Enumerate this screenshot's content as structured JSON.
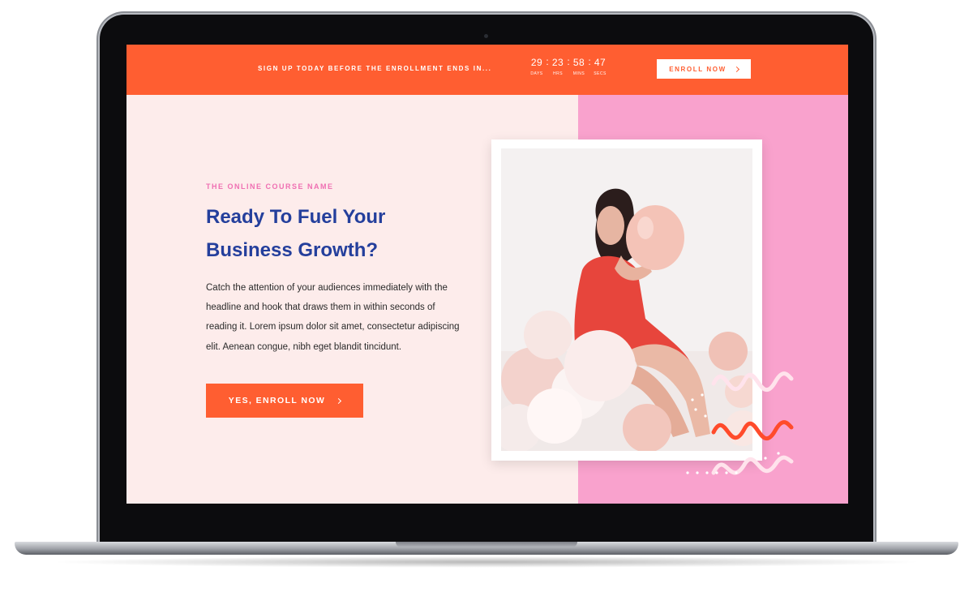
{
  "topbar": {
    "promo_text": "SIGN UP TODAY BEFORE THE ENROLLMENT ENDS IN...",
    "countdown": [
      {
        "value": "29",
        "label": "DAYS"
      },
      {
        "value": "23",
        "label": "HRS"
      },
      {
        "value": "58",
        "label": "MINS"
      },
      {
        "value": "47",
        "label": "SECS"
      }
    ],
    "separator": ":",
    "enroll_label": "ENROLL NOW"
  },
  "hero": {
    "eyebrow": "THE ONLINE COURSE NAME",
    "headline_line1": "Ready To Fuel Your",
    "headline_line2": "Business Growth?",
    "body": "Catch the attention of your audiences immediately with the headline and hook that draws them in within seconds of reading it. Lorem ipsum dolor sit amet, consectetur adipiscing elit. Aenean congue, nibh eget blandit tincidunt.",
    "cta_label": "YES, ENROLL NOW"
  },
  "colors": {
    "accent_orange": "#ff5e31",
    "headline_blue": "#243f9c",
    "eyebrow_pink": "#ef6fb2",
    "panel_pink": "#f9a2cd",
    "page_bg": "#fdeceb"
  },
  "icons": {
    "enroll_arrow": "chevron-right-icon",
    "cta_arrow": "chevron-right-icon",
    "decor": "squiggle-decoration"
  }
}
